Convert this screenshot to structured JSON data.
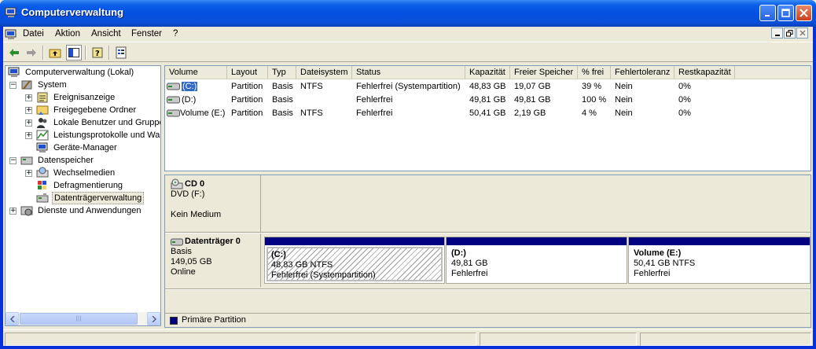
{
  "window": {
    "title": "Computerverwaltung"
  },
  "menu": [
    "Datei",
    "Aktion",
    "Ansicht",
    "Fenster",
    "?"
  ],
  "tree": [
    {
      "label": "Computerverwaltung (Lokal)",
      "icon": "computer-icon"
    },
    {
      "label": "System",
      "icon": "tools-icon"
    },
    {
      "label": "Ereignisanzeige",
      "icon": "event-viewer-icon"
    },
    {
      "label": "Freigegebene Ordner",
      "icon": "shared-folder-icon"
    },
    {
      "label": "Lokale Benutzer und Gruppen",
      "icon": "users-icon"
    },
    {
      "label": "Leistungsprotokolle und Warnungen",
      "icon": "performance-icon"
    },
    {
      "label": "Geräte-Manager",
      "icon": "device-manager-icon"
    },
    {
      "label": "Datenspeicher",
      "icon": "storage-icon"
    },
    {
      "label": "Wechselmedien",
      "icon": "removable-media-icon"
    },
    {
      "label": "Defragmentierung",
      "icon": "defrag-icon"
    },
    {
      "label": "Datenträgerverwaltung",
      "icon": "disk-management-icon"
    },
    {
      "label": "Dienste und Anwendungen",
      "icon": "services-icon"
    }
  ],
  "volumes": {
    "columns": [
      "Volume",
      "Layout",
      "Typ",
      "Dateisystem",
      "Status",
      "Kapazität",
      "Freier Speicher",
      "% frei",
      "Fehlertoleranz",
      "Restkapazität"
    ],
    "rows": [
      [
        "(C:)",
        "Partition",
        "Basis",
        "NTFS",
        "Fehlerfrei (Systempartition)",
        "48,83 GB",
        "19,07 GB",
        "39 %",
        "Nein",
        "0%"
      ],
      [
        "(D:)",
        "Partition",
        "Basis",
        "",
        "Fehlerfrei",
        "49,81 GB",
        "49,81 GB",
        "100 %",
        "Nein",
        "0%"
      ],
      [
        "Volume (E:)",
        "Partition",
        "Basis",
        "NTFS",
        "Fehlerfrei",
        "50,41 GB",
        "2,19 GB",
        "4 %",
        "Nein",
        "0%"
      ]
    ]
  },
  "disks": [
    {
      "name": "CD 0",
      "line1": "DVD (F:)",
      "line2": "",
      "line3": "Kein Medium"
    },
    {
      "name": "Datenträger 0",
      "line1": "Basis",
      "line2": "149,05 GB",
      "line3": "Online"
    }
  ],
  "partitions": [
    {
      "name": "(C:)",
      "size": "48,83 GB NTFS",
      "status": "Fehlerfrei (Systempartition)"
    },
    {
      "name": "(D:)",
      "size": "49,81 GB",
      "status": "Fehlerfrei"
    },
    {
      "name": "Volume  (E:)",
      "size": "50,41 GB NTFS",
      "status": "Fehlerfrei"
    }
  ],
  "legend": {
    "label": "Primäre Partition",
    "color": "#000080"
  }
}
